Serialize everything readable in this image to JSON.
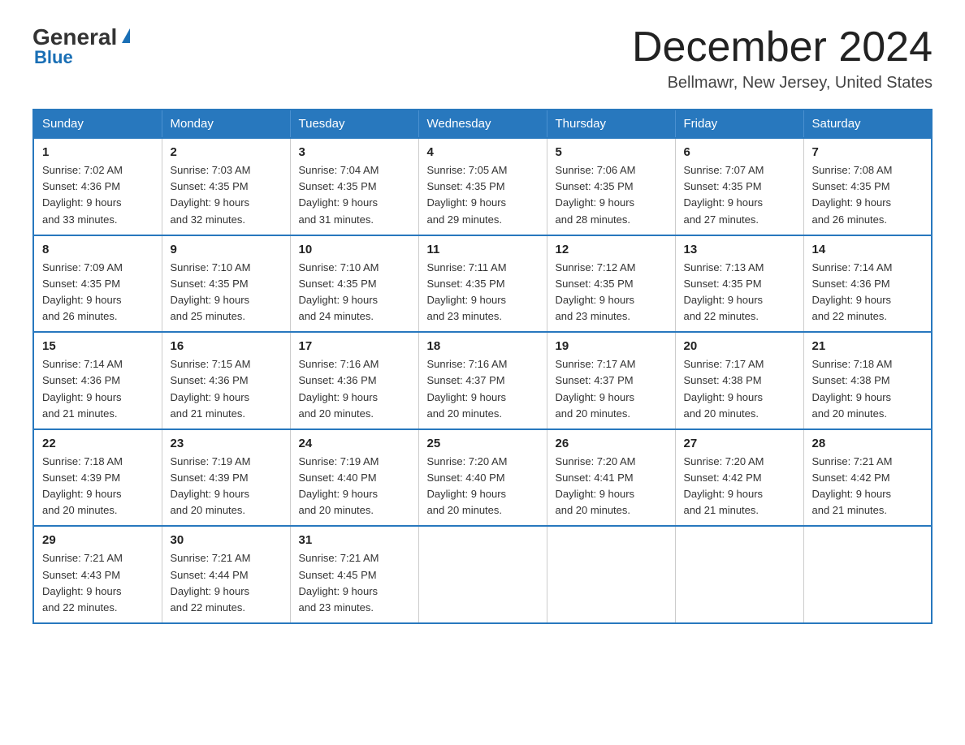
{
  "header": {
    "logo": {
      "general": "General",
      "triangle": "",
      "blue": "Blue"
    },
    "title": "December 2024",
    "location": "Bellmawr, New Jersey, United States"
  },
  "weekdays": [
    "Sunday",
    "Monday",
    "Tuesday",
    "Wednesday",
    "Thursday",
    "Friday",
    "Saturday"
  ],
  "weeks": [
    [
      {
        "day": "1",
        "sunrise": "7:02 AM",
        "sunset": "4:36 PM",
        "daylight": "9 hours and 33 minutes."
      },
      {
        "day": "2",
        "sunrise": "7:03 AM",
        "sunset": "4:35 PM",
        "daylight": "9 hours and 32 minutes."
      },
      {
        "day": "3",
        "sunrise": "7:04 AM",
        "sunset": "4:35 PM",
        "daylight": "9 hours and 31 minutes."
      },
      {
        "day": "4",
        "sunrise": "7:05 AM",
        "sunset": "4:35 PM",
        "daylight": "9 hours and 29 minutes."
      },
      {
        "day": "5",
        "sunrise": "7:06 AM",
        "sunset": "4:35 PM",
        "daylight": "9 hours and 28 minutes."
      },
      {
        "day": "6",
        "sunrise": "7:07 AM",
        "sunset": "4:35 PM",
        "daylight": "9 hours and 27 minutes."
      },
      {
        "day": "7",
        "sunrise": "7:08 AM",
        "sunset": "4:35 PM",
        "daylight": "9 hours and 26 minutes."
      }
    ],
    [
      {
        "day": "8",
        "sunrise": "7:09 AM",
        "sunset": "4:35 PM",
        "daylight": "9 hours and 26 minutes."
      },
      {
        "day": "9",
        "sunrise": "7:10 AM",
        "sunset": "4:35 PM",
        "daylight": "9 hours and 25 minutes."
      },
      {
        "day": "10",
        "sunrise": "7:10 AM",
        "sunset": "4:35 PM",
        "daylight": "9 hours and 24 minutes."
      },
      {
        "day": "11",
        "sunrise": "7:11 AM",
        "sunset": "4:35 PM",
        "daylight": "9 hours and 23 minutes."
      },
      {
        "day": "12",
        "sunrise": "7:12 AM",
        "sunset": "4:35 PM",
        "daylight": "9 hours and 23 minutes."
      },
      {
        "day": "13",
        "sunrise": "7:13 AM",
        "sunset": "4:35 PM",
        "daylight": "9 hours and 22 minutes."
      },
      {
        "day": "14",
        "sunrise": "7:14 AM",
        "sunset": "4:36 PM",
        "daylight": "9 hours and 22 minutes."
      }
    ],
    [
      {
        "day": "15",
        "sunrise": "7:14 AM",
        "sunset": "4:36 PM",
        "daylight": "9 hours and 21 minutes."
      },
      {
        "day": "16",
        "sunrise": "7:15 AM",
        "sunset": "4:36 PM",
        "daylight": "9 hours and 21 minutes."
      },
      {
        "day": "17",
        "sunrise": "7:16 AM",
        "sunset": "4:36 PM",
        "daylight": "9 hours and 20 minutes."
      },
      {
        "day": "18",
        "sunrise": "7:16 AM",
        "sunset": "4:37 PM",
        "daylight": "9 hours and 20 minutes."
      },
      {
        "day": "19",
        "sunrise": "7:17 AM",
        "sunset": "4:37 PM",
        "daylight": "9 hours and 20 minutes."
      },
      {
        "day": "20",
        "sunrise": "7:17 AM",
        "sunset": "4:38 PM",
        "daylight": "9 hours and 20 minutes."
      },
      {
        "day": "21",
        "sunrise": "7:18 AM",
        "sunset": "4:38 PM",
        "daylight": "9 hours and 20 minutes."
      }
    ],
    [
      {
        "day": "22",
        "sunrise": "7:18 AM",
        "sunset": "4:39 PM",
        "daylight": "9 hours and 20 minutes."
      },
      {
        "day": "23",
        "sunrise": "7:19 AM",
        "sunset": "4:39 PM",
        "daylight": "9 hours and 20 minutes."
      },
      {
        "day": "24",
        "sunrise": "7:19 AM",
        "sunset": "4:40 PM",
        "daylight": "9 hours and 20 minutes."
      },
      {
        "day": "25",
        "sunrise": "7:20 AM",
        "sunset": "4:40 PM",
        "daylight": "9 hours and 20 minutes."
      },
      {
        "day": "26",
        "sunrise": "7:20 AM",
        "sunset": "4:41 PM",
        "daylight": "9 hours and 20 minutes."
      },
      {
        "day": "27",
        "sunrise": "7:20 AM",
        "sunset": "4:42 PM",
        "daylight": "9 hours and 21 minutes."
      },
      {
        "day": "28",
        "sunrise": "7:21 AM",
        "sunset": "4:42 PM",
        "daylight": "9 hours and 21 minutes."
      }
    ],
    [
      {
        "day": "29",
        "sunrise": "7:21 AM",
        "sunset": "4:43 PM",
        "daylight": "9 hours and 22 minutes."
      },
      {
        "day": "30",
        "sunrise": "7:21 AM",
        "sunset": "4:44 PM",
        "daylight": "9 hours and 22 minutes."
      },
      {
        "day": "31",
        "sunrise": "7:21 AM",
        "sunset": "4:45 PM",
        "daylight": "9 hours and 23 minutes."
      },
      null,
      null,
      null,
      null
    ]
  ]
}
